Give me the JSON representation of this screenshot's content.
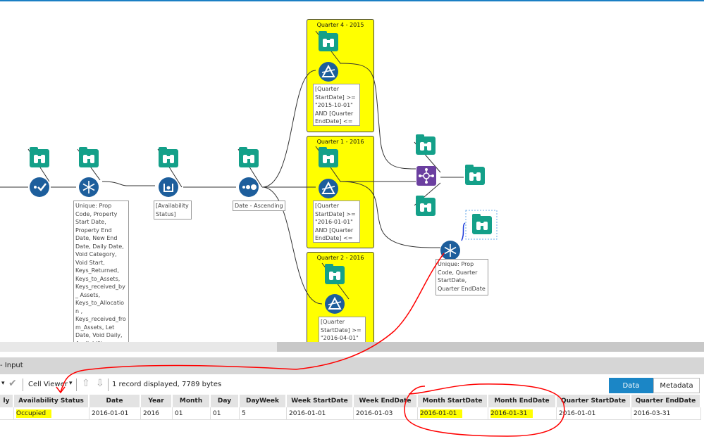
{
  "canvas": {
    "containers": [
      {
        "title": "Quarter 4 - 2015",
        "filter": "[Quarter StartDate] >= \"2015-10-01\" AND [Quarter EndDate] <= ..."
      },
      {
        "title": "Quarter 1 - 2016",
        "filter": "[Quarter StartDate] >= \"2016-01-01\" AND [Quarter EndDate] <= ..."
      },
      {
        "title": "Quarter 2 - 2016",
        "filter": "[Quarter StartDate] >= \"2016-04-01\""
      }
    ],
    "annotations": {
      "unique1": "Unique: Prop Code, Property Start Date, Property End Date, New End Date, Daily Date, Void Category, Void Start, Keys_Returned, Keys_to_Assets, Keys_received_by_ Assets, Keys_to_Allocation , Keys_received_fro m_Assets, Let Date, Void Daily, Availability Status,",
      "formula": "[Availability Status]",
      "sort": "Date - Ascending",
      "unique2": "Unique: Prop Code, Quarter StartDate, Quarter EndDate"
    },
    "colors": {
      "container": "#ffff00",
      "browse": "#14a089",
      "tool": "#1d5e9c",
      "join": "#6b3fa0",
      "annotation_ink": "#ff0000"
    }
  },
  "results": {
    "title": "- Input",
    "cell_viewer": "Cell Viewer",
    "status": "1 record displayed, 7789 bytes",
    "tabs": {
      "data": "Data",
      "metadata": "Metadata"
    },
    "columns": [
      "ly",
      "Availability Status",
      "Date",
      "Year",
      "Month",
      "Day",
      "DayWeek",
      "Week StartDate",
      "Week EndDate",
      "Month StartDate",
      "Month EndDate",
      "Quarter StartDate",
      "Quarter EndDate"
    ],
    "row": [
      "",
      "Occupied",
      "2016-01-01",
      "2016",
      "01",
      "01",
      "5",
      "2016-01-01",
      "2016-01-03",
      "2016-01-01",
      "2016-01-31",
      "2016-01-01",
      "2016-03-31"
    ],
    "highlighted_columns": [
      "Availability Status",
      "Month StartDate",
      "Month EndDate"
    ]
  }
}
